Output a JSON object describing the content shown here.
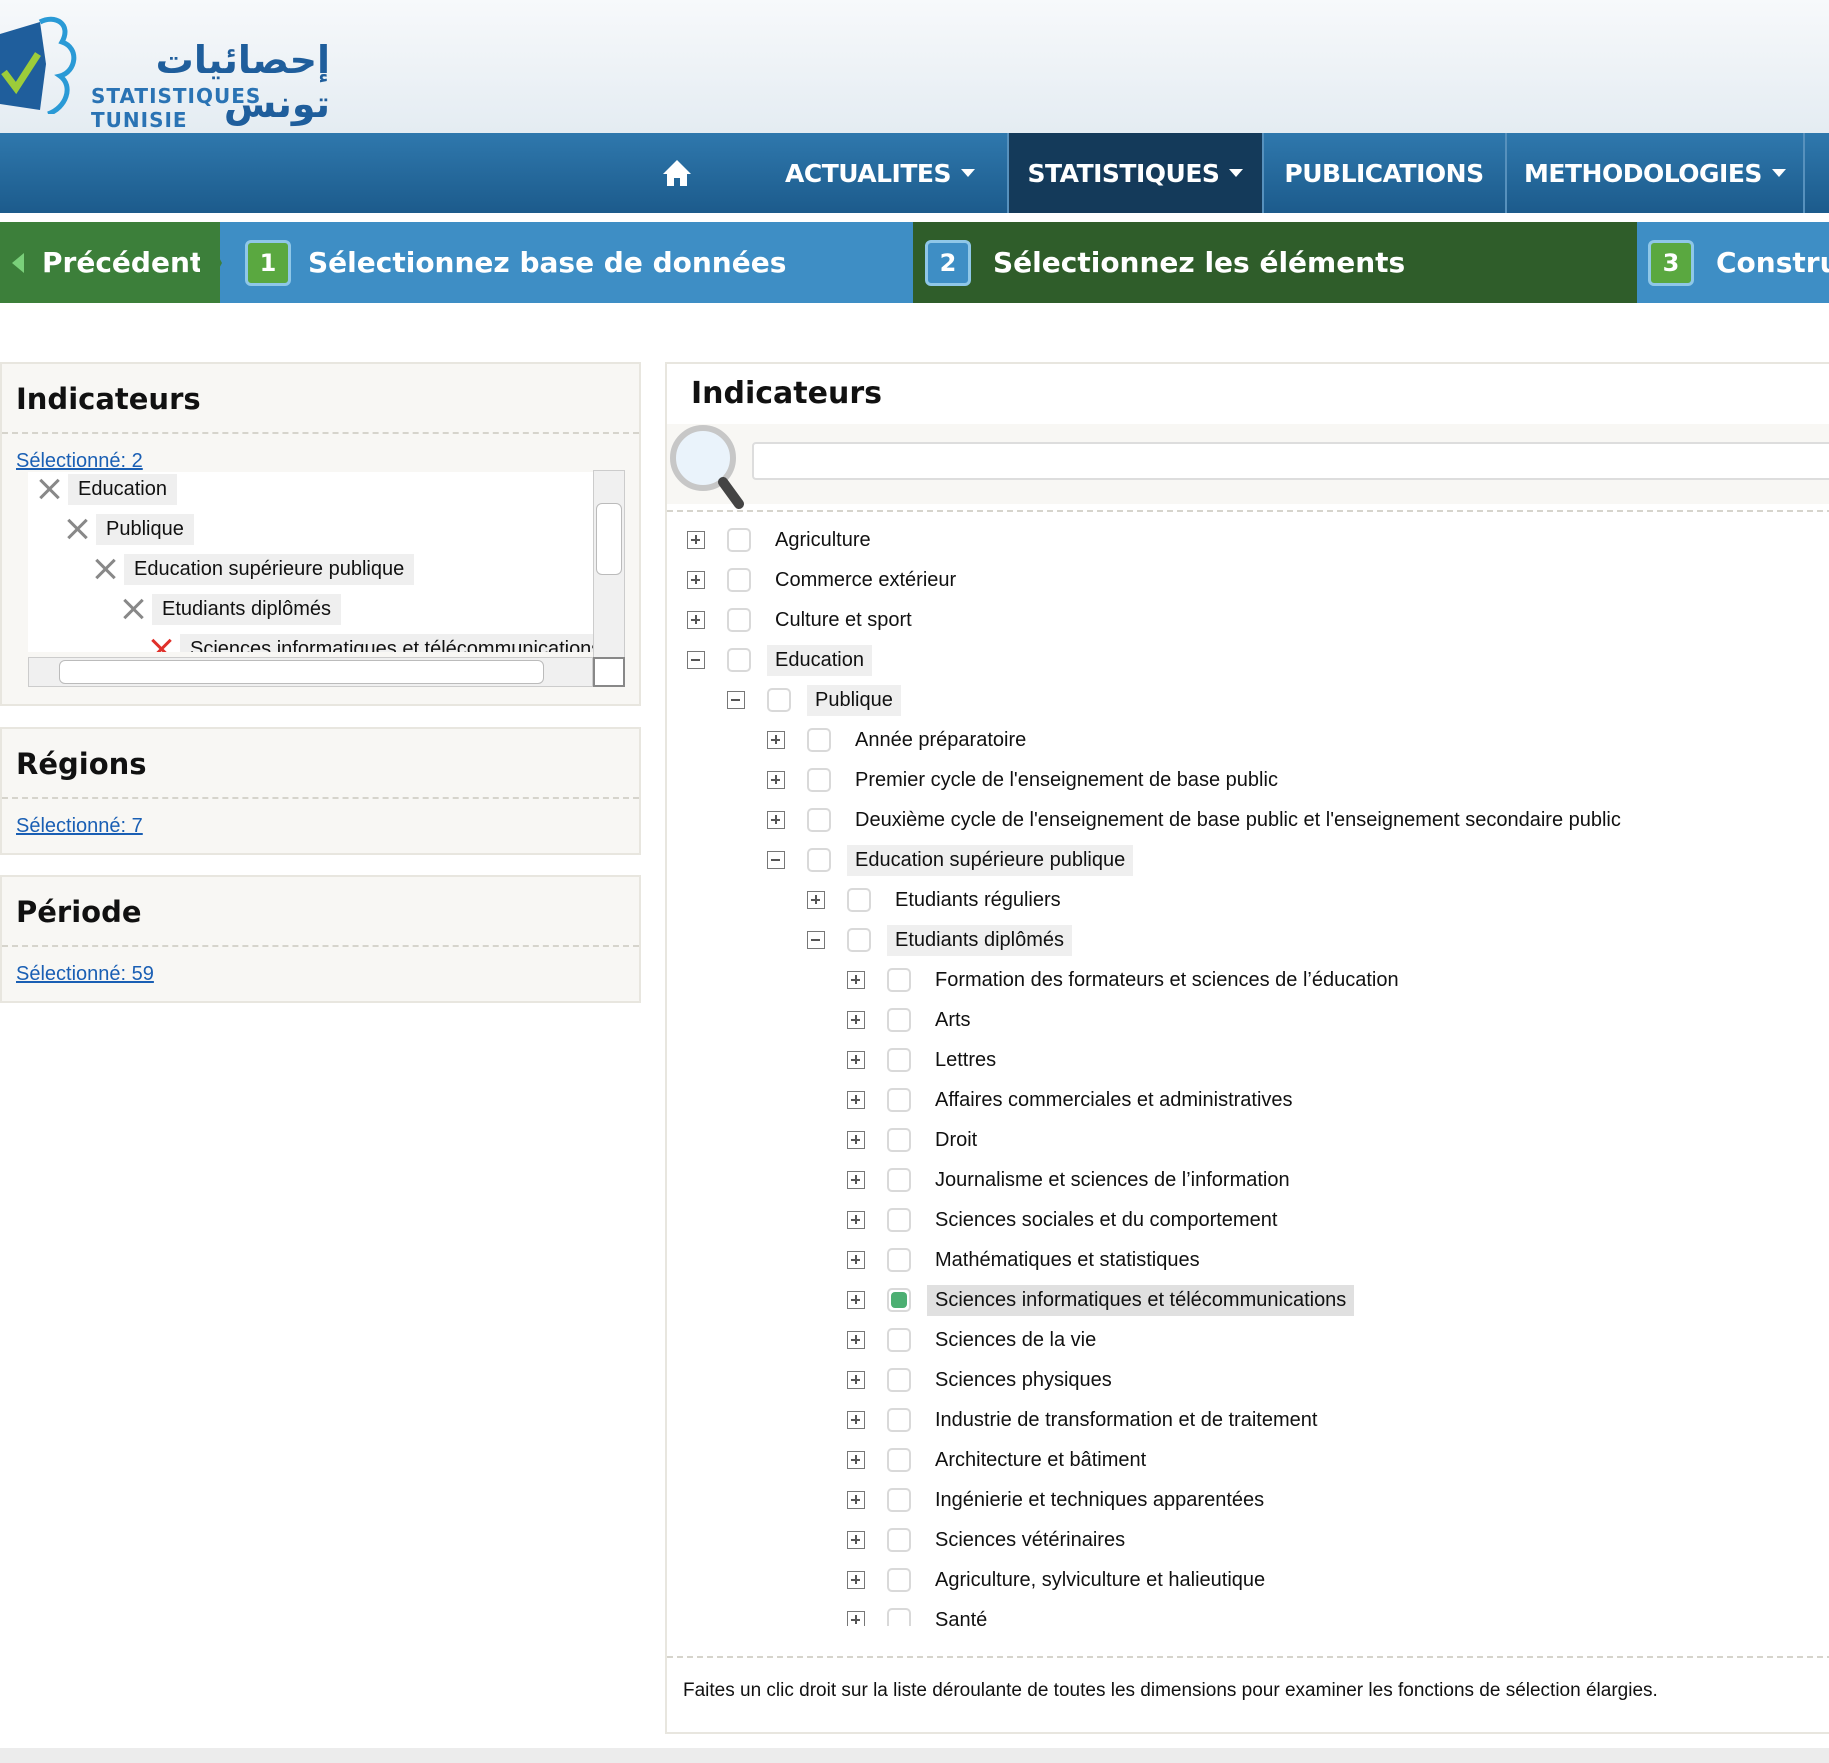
{
  "logo": {
    "arabic": "إحصائيات تونس",
    "french": "STATISTIQUES TUNISIE"
  },
  "nav": {
    "items": [
      {
        "label": "ACTUALITES",
        "dropdown": true
      },
      {
        "label": "STATISTIQUES",
        "dropdown": true,
        "active": true
      },
      {
        "label": "PUBLICATIONS",
        "dropdown": false
      },
      {
        "label": "METHODOLOGIES",
        "dropdown": true
      }
    ]
  },
  "steps": {
    "previous": "Précédent",
    "items": [
      {
        "number": "1",
        "label": "Sélectionnez base de données"
      },
      {
        "number": "2",
        "label": "Sélectionnez les éléments"
      },
      {
        "number": "3",
        "label": "Construi"
      }
    ]
  },
  "left": {
    "indicateurs": {
      "title": "Indicateurs",
      "selected": "Sélectionné: 2",
      "tree": [
        "Education",
        "Publique",
        "Education supérieure publique",
        "Etudiants diplômés",
        "Sciences informatiques et télécommunications"
      ]
    },
    "regions": {
      "title": "Régions",
      "selected": "Sélectionné: 7"
    },
    "periode": {
      "title": "Période",
      "selected": "Sélectionné: 59"
    }
  },
  "right": {
    "title": "Indicateurs",
    "search_placeholder": "",
    "tree": [
      "Agriculture",
      "Commerce extérieur",
      "Culture et sport",
      "Education",
      "Publique",
      "Année préparatoire",
      "Premier cycle de l'enseignement de base public",
      "Deuxième cycle de l'enseignement de base public et l'enseignement secondaire public",
      "Education supérieure publique",
      "Etudiants réguliers",
      "Etudiants diplômés",
      "Formation des formateurs et sciences de l’éducation",
      "Arts",
      "Lettres",
      "Affaires commerciales et administratives",
      "Droit",
      "Journalisme et sciences de l’information",
      "Sciences sociales et du comportement",
      "Mathématiques et statistiques",
      "Sciences informatiques et télécommunications",
      "Sciences de la vie",
      "Sciences physiques",
      "Industrie de transformation et de traitement",
      "Architecture et bâtiment",
      "Ingénierie et techniques apparentées",
      "Sciences vétérinaires",
      "Agriculture, sylviculture et halieutique",
      "Santé"
    ],
    "footer_note": "Faites un clic droit sur la liste déroulante de toutes les dimensions pour examiner les fonctions de sélection élargies."
  }
}
